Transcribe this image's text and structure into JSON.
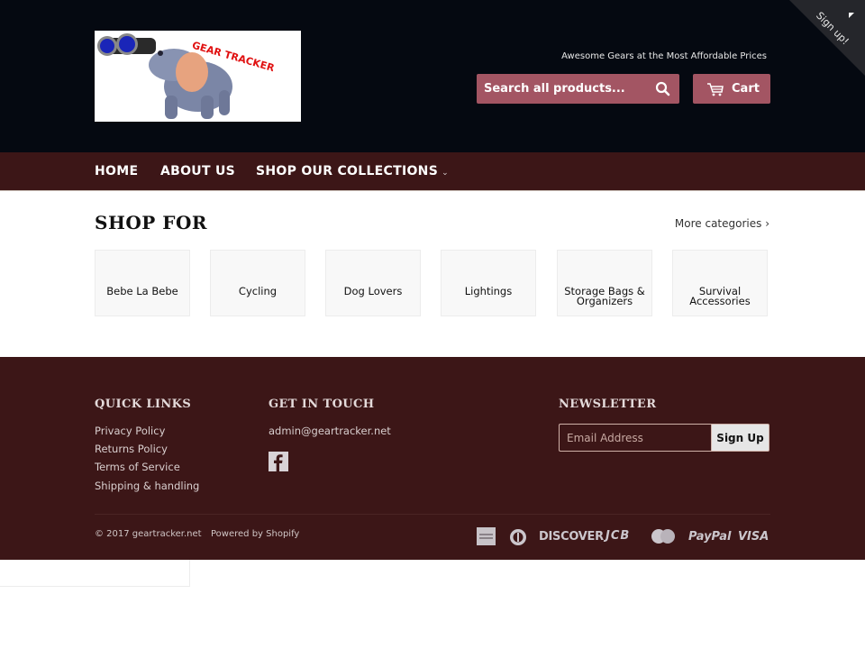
{
  "header": {
    "logo_text": "GEAR TRACKER",
    "tagline": "Awesome Gears at the Most Affordable Prices",
    "search_placeholder": "Search all products...",
    "cart_label": "Cart",
    "ribbon_label": "Sign up!",
    "accent_color": "#a35563"
  },
  "nav": {
    "items": [
      {
        "label": "HOME"
      },
      {
        "label": "ABOUT US"
      },
      {
        "label": "SHOP OUR COLLECTIONS",
        "dropdown_icon": "chevron-down"
      }
    ]
  },
  "main": {
    "title": "SHOP FOR",
    "more_link": "More categories ›",
    "categories": [
      {
        "label": "Bebe La Bebe"
      },
      {
        "label": "Cycling"
      },
      {
        "label": "Dog Lovers"
      },
      {
        "label": "Lightings"
      },
      {
        "label": "Storage Bags & Organizers"
      },
      {
        "label": "Survival Accessories"
      }
    ]
  },
  "footer": {
    "quick_links_title": "QUICK LINKS",
    "quick_links": [
      {
        "label": "Privacy Policy"
      },
      {
        "label": "Returns Policy"
      },
      {
        "label": "Terms of Service"
      },
      {
        "label": "Shipping & handling"
      }
    ],
    "contact_title": "GET IN TOUCH",
    "contact_email": "admin@geartracker.net",
    "social_icon": "facebook-icon",
    "newsletter_title": "NEWSLETTER",
    "newsletter_placeholder": "Email Address",
    "newsletter_button": "Sign Up",
    "copyright": "© 2017 geartracker.net",
    "powered_by": "Powered by Shopify",
    "payment_methods": [
      "American Express",
      "Diners Club",
      "DISCOVER",
      "JCB",
      "MasterCard",
      "PayPal",
      "VISA"
    ],
    "background_color": "#3c1617"
  }
}
